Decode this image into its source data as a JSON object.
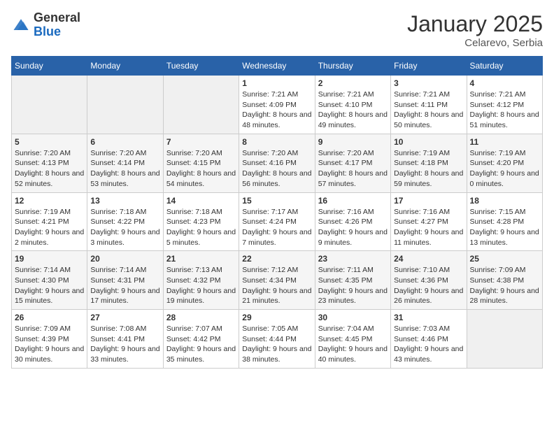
{
  "header": {
    "logo_general": "General",
    "logo_blue": "Blue",
    "month_year": "January 2025",
    "location": "Celarevo, Serbia"
  },
  "days_of_week": [
    "Sunday",
    "Monday",
    "Tuesday",
    "Wednesday",
    "Thursday",
    "Friday",
    "Saturday"
  ],
  "weeks": [
    [
      {
        "day": "",
        "info": ""
      },
      {
        "day": "",
        "info": ""
      },
      {
        "day": "",
        "info": ""
      },
      {
        "day": "1",
        "info": "Sunrise: 7:21 AM\nSunset: 4:09 PM\nDaylight: 8 hours and 48 minutes."
      },
      {
        "day": "2",
        "info": "Sunrise: 7:21 AM\nSunset: 4:10 PM\nDaylight: 8 hours and 49 minutes."
      },
      {
        "day": "3",
        "info": "Sunrise: 7:21 AM\nSunset: 4:11 PM\nDaylight: 8 hours and 50 minutes."
      },
      {
        "day": "4",
        "info": "Sunrise: 7:21 AM\nSunset: 4:12 PM\nDaylight: 8 hours and 51 minutes."
      }
    ],
    [
      {
        "day": "5",
        "info": "Sunrise: 7:20 AM\nSunset: 4:13 PM\nDaylight: 8 hours and 52 minutes."
      },
      {
        "day": "6",
        "info": "Sunrise: 7:20 AM\nSunset: 4:14 PM\nDaylight: 8 hours and 53 minutes."
      },
      {
        "day": "7",
        "info": "Sunrise: 7:20 AM\nSunset: 4:15 PM\nDaylight: 8 hours and 54 minutes."
      },
      {
        "day": "8",
        "info": "Sunrise: 7:20 AM\nSunset: 4:16 PM\nDaylight: 8 hours and 56 minutes."
      },
      {
        "day": "9",
        "info": "Sunrise: 7:20 AM\nSunset: 4:17 PM\nDaylight: 8 hours and 57 minutes."
      },
      {
        "day": "10",
        "info": "Sunrise: 7:19 AM\nSunset: 4:18 PM\nDaylight: 8 hours and 59 minutes."
      },
      {
        "day": "11",
        "info": "Sunrise: 7:19 AM\nSunset: 4:20 PM\nDaylight: 9 hours and 0 minutes."
      }
    ],
    [
      {
        "day": "12",
        "info": "Sunrise: 7:19 AM\nSunset: 4:21 PM\nDaylight: 9 hours and 2 minutes."
      },
      {
        "day": "13",
        "info": "Sunrise: 7:18 AM\nSunset: 4:22 PM\nDaylight: 9 hours and 3 minutes."
      },
      {
        "day": "14",
        "info": "Sunrise: 7:18 AM\nSunset: 4:23 PM\nDaylight: 9 hours and 5 minutes."
      },
      {
        "day": "15",
        "info": "Sunrise: 7:17 AM\nSunset: 4:24 PM\nDaylight: 9 hours and 7 minutes."
      },
      {
        "day": "16",
        "info": "Sunrise: 7:16 AM\nSunset: 4:26 PM\nDaylight: 9 hours and 9 minutes."
      },
      {
        "day": "17",
        "info": "Sunrise: 7:16 AM\nSunset: 4:27 PM\nDaylight: 9 hours and 11 minutes."
      },
      {
        "day": "18",
        "info": "Sunrise: 7:15 AM\nSunset: 4:28 PM\nDaylight: 9 hours and 13 minutes."
      }
    ],
    [
      {
        "day": "19",
        "info": "Sunrise: 7:14 AM\nSunset: 4:30 PM\nDaylight: 9 hours and 15 minutes."
      },
      {
        "day": "20",
        "info": "Sunrise: 7:14 AM\nSunset: 4:31 PM\nDaylight: 9 hours and 17 minutes."
      },
      {
        "day": "21",
        "info": "Sunrise: 7:13 AM\nSunset: 4:32 PM\nDaylight: 9 hours and 19 minutes."
      },
      {
        "day": "22",
        "info": "Sunrise: 7:12 AM\nSunset: 4:34 PM\nDaylight: 9 hours and 21 minutes."
      },
      {
        "day": "23",
        "info": "Sunrise: 7:11 AM\nSunset: 4:35 PM\nDaylight: 9 hours and 23 minutes."
      },
      {
        "day": "24",
        "info": "Sunrise: 7:10 AM\nSunset: 4:36 PM\nDaylight: 9 hours and 26 minutes."
      },
      {
        "day": "25",
        "info": "Sunrise: 7:09 AM\nSunset: 4:38 PM\nDaylight: 9 hours and 28 minutes."
      }
    ],
    [
      {
        "day": "26",
        "info": "Sunrise: 7:09 AM\nSunset: 4:39 PM\nDaylight: 9 hours and 30 minutes."
      },
      {
        "day": "27",
        "info": "Sunrise: 7:08 AM\nSunset: 4:41 PM\nDaylight: 9 hours and 33 minutes."
      },
      {
        "day": "28",
        "info": "Sunrise: 7:07 AM\nSunset: 4:42 PM\nDaylight: 9 hours and 35 minutes."
      },
      {
        "day": "29",
        "info": "Sunrise: 7:05 AM\nSunset: 4:44 PM\nDaylight: 9 hours and 38 minutes."
      },
      {
        "day": "30",
        "info": "Sunrise: 7:04 AM\nSunset: 4:45 PM\nDaylight: 9 hours and 40 minutes."
      },
      {
        "day": "31",
        "info": "Sunrise: 7:03 AM\nSunset: 4:46 PM\nDaylight: 9 hours and 43 minutes."
      },
      {
        "day": "",
        "info": ""
      }
    ]
  ]
}
